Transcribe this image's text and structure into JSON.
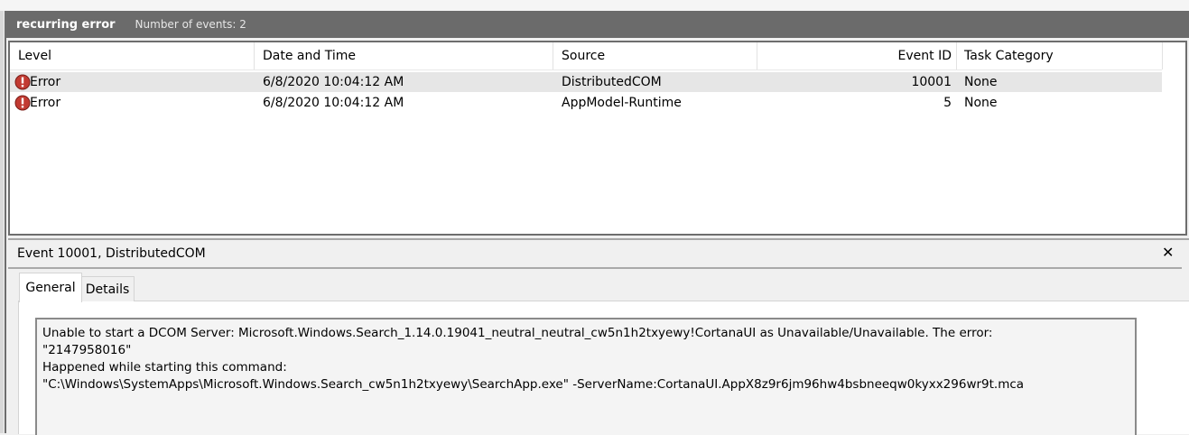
{
  "window": {
    "title": "recurring error",
    "event_count": "Number of events: 2"
  },
  "grid": {
    "columns": [
      "Level",
      "Date and Time",
      "Source",
      "Event ID",
      "Task Category"
    ],
    "rows": [
      {
        "level": "Error",
        "datetime": "6/8/2020 10:04:12 AM",
        "source": "DistributedCOM",
        "event_id": "10001",
        "task": "None",
        "selected": true
      },
      {
        "level": "Error",
        "datetime": "6/8/2020 10:04:12 AM",
        "source": "AppModel-Runtime",
        "event_id": "5",
        "task": "None",
        "selected": false
      }
    ]
  },
  "detail": {
    "title": "Event 10001, DistributedCOM",
    "close_icon": "close-icon",
    "tabs": [
      "General",
      "Details"
    ],
    "description_lines": [
      "Unable to start a DCOM Server: Microsoft.Windows.Search_1.14.0.19041_neutral_neutral_cw5n1h2txyewy!CortanaUI as Unavailable/Unavailable. The error:",
      "\"2147958016\"",
      "Happened while starting this command:",
      "\"C:\\Windows\\SystemApps\\Microsoft.Windows.Search_cw5n1h2txyewy\\SearchApp.exe\" -ServerName:CortanaUI.AppX8z9r6jm96hw4bsbneeqw0kyxx296wr9t.mca"
    ]
  },
  "colors": {
    "title_bar": "#6b6b6b",
    "error_icon": "#c0392b",
    "selected_row": "#e6e6e6"
  }
}
